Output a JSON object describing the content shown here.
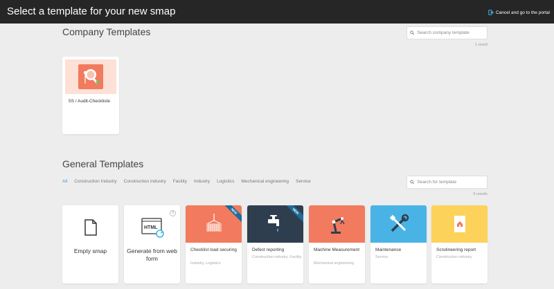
{
  "header": {
    "title": "Select a template for your new smap",
    "cancel_label": "Cancel and go to the portal"
  },
  "company": {
    "section_title": "Company Templates",
    "search_placeholder": "Search company template",
    "result_count": "1 result",
    "templates": [
      {
        "label": "5S / Audit-Checkliste",
        "icon": "magnifier-audit-icon",
        "color": "#f27a5e"
      }
    ]
  },
  "general": {
    "section_title": "General Templates",
    "search_placeholder": "Search for template",
    "result_count": "9 results",
    "filters": [
      "All",
      "Construction Industry",
      "Construction industry",
      "Facility",
      "Industry",
      "Logistics",
      "Mechanical engineering",
      "Service"
    ],
    "active_filter": "All",
    "templates": [
      {
        "title": "Empty smap",
        "icon": "document-icon"
      },
      {
        "title": "Generate from web form",
        "icon": "html-icon"
      },
      {
        "title": "Checklist load securing",
        "subtitle": "Industry, Logistics",
        "badge": "NEW",
        "icon": "crane-container-icon",
        "color": "#f27a5e"
      },
      {
        "title": "Defect reporting",
        "subtitle": "Construction industry, Facility",
        "badge": "NEW",
        "icon": "faucet-icon",
        "color": "#2f3e4e"
      },
      {
        "title": "Machine Measurement",
        "subtitle": "Mechanical engineering",
        "icon": "robot-arm-icon",
        "color": "#f27a5e"
      },
      {
        "title": "Maintenance",
        "subtitle": "Service",
        "icon": "tools-icon",
        "color": "#4ab3e6"
      },
      {
        "title": "Scrutineering report",
        "subtitle": "Construction industry",
        "icon": "house-report-icon",
        "color": "#fcd25a"
      }
    ]
  }
}
